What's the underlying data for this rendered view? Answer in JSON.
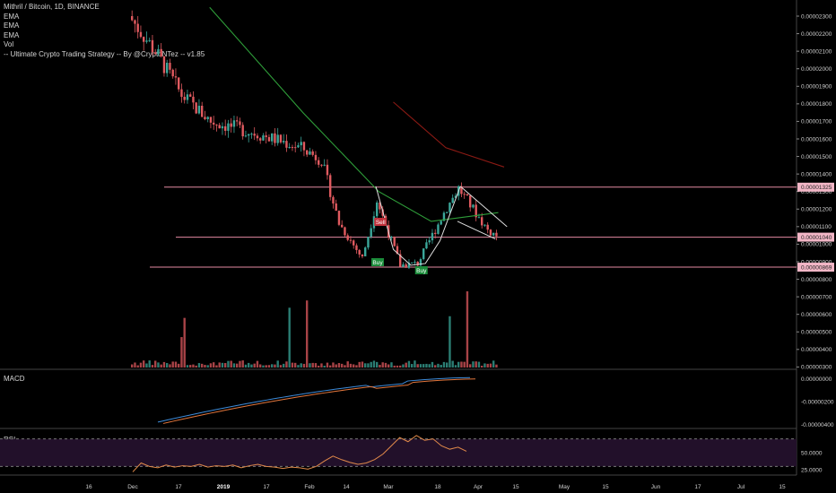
{
  "legend": {
    "title": "Mithril / Bitcoin, 1D, BINANCE",
    "lines": [
      "EMA",
      "EMA",
      "EMA",
      "Vol",
      "-- Ultimate Crypto Trading Strategy -- By @CryptoNTez -- v1.85"
    ]
  },
  "panes": {
    "macd": "MACD",
    "rsi": "RSI"
  },
  "colors": {
    "up": "#3aa79a",
    "down": "#e05a5f",
    "ema_green": "#2f9e3a",
    "ema_red": "#8b1a14",
    "level_line": "#e48aa2",
    "macd": "#3d8bd9",
    "signal": "#e2763c",
    "rsi_line": "#e0894a",
    "rsi_band": "#22102a",
    "buy": "#1b8c3a",
    "sell": "#c0303a",
    "pattern": "#dddddd"
  },
  "chart_data": {
    "type": "candlestick",
    "title": "Mithril / Bitcoin, 1D, BINANCE",
    "price_axis": {
      "ticks": [
        2.3e-05,
        2.2e-05,
        2.1e-05,
        2e-05,
        1.9e-05,
        1.8e-05,
        1.7e-05,
        1.6e-05,
        1.5e-05,
        1.4e-05,
        1.3e-05,
        1.2e-05,
        1.1e-05,
        1e-05,
        9e-06,
        8e-06,
        7e-06,
        6e-06,
        5e-06,
        4e-06,
        3e-06
      ],
      "tick_labels": [
        "0.00002300",
        "0.00002200",
        "0.00002100",
        "0.00002000",
        "0.00001900",
        "0.00001800",
        "0.00001700",
        "0.00001600",
        "0.00001500",
        "0.00001400",
        "0.00001300",
        "0.00001200",
        "0.00001100",
        "0.00001000",
        "0.00000900",
        "0.00000800",
        "0.00000700",
        "0.00000600",
        "0.00000500",
        "0.00000400",
        "0.00000300"
      ],
      "range": [
        3e-06,
        2.35e-05
      ]
    },
    "horizontal_levels": [
      {
        "value": 1.325e-05,
        "label": "0.00001325"
      },
      {
        "value": 1.04e-05,
        "label": "0.00001040"
      },
      {
        "value": 8.69e-06,
        "label": "0.00000869"
      }
    ],
    "x_axis": {
      "labels": [
        "16",
        "Dec",
        "17",
        "2019",
        "17",
        "Feb",
        "14",
        "Mar",
        "18",
        "Apr",
        "15",
        "May",
        "15",
        "Jun",
        "17",
        "Jul",
        "15"
      ]
    },
    "signals": [
      {
        "type": "Buy",
        "date": "2019-02-14"
      },
      {
        "type": "Sell",
        "date": "2019-02-15"
      },
      {
        "type": "Buy",
        "date": "2019-03-01"
      }
    ],
    "price_key_points": [
      {
        "date": "2018-11-22",
        "close": 2.3e-05
      },
      {
        "date": "2018-12-01",
        "close": 2.1e-05
      },
      {
        "date": "2018-12-10",
        "close": 1.85e-05
      },
      {
        "date": "2018-12-20",
        "close": 1.7e-05
      },
      {
        "date": "2019-01-05",
        "close": 1.63e-05
      },
      {
        "date": "2019-01-20",
        "close": 1.55e-05
      },
      {
        "date": "2019-01-27",
        "close": 1.48e-05
      },
      {
        "date": "2019-02-02",
        "close": 1.12e-05
      },
      {
        "date": "2019-02-10",
        "close": 9.2e-06
      },
      {
        "date": "2019-02-15",
        "close": 1.25e-05
      },
      {
        "date": "2019-02-23",
        "close": 8.8e-06
      },
      {
        "date": "2019-03-01",
        "close": 8.9e-06
      },
      {
        "date": "2019-03-10",
        "close": 1.18e-05
      },
      {
        "date": "2019-03-15",
        "close": 1.32e-05
      },
      {
        "date": "2019-03-25",
        "close": 1.08e-05
      },
      {
        "date": "2019-03-28",
        "close": 1.05e-05
      }
    ],
    "ema_green": [
      {
        "date": "2018-12-19",
        "value": 2.35e-05
      },
      {
        "date": "2019-01-20",
        "value": 1.75e-05
      },
      {
        "date": "2019-02-15",
        "value": 1.3e-05
      },
      {
        "date": "2019-03-05",
        "value": 1.13e-05
      },
      {
        "date": "2019-03-28",
        "value": 1.18e-05
      }
    ],
    "ema_red": [
      {
        "date": "2019-02-20",
        "value": 1.81e-05
      },
      {
        "date": "2019-03-10",
        "value": 1.55e-05
      },
      {
        "date": "2019-03-30",
        "value": 1.44e-05
      }
    ],
    "macd_axis": {
      "tick_labels": [
        "0.00000000",
        "-0.00000200",
        "-0.00000400"
      ],
      "range": [
        -4.2e-06,
        2e-07
      ]
    },
    "rsi_axis": {
      "tick_labels": [
        "50.0000",
        "25.0000"
      ],
      "bands": [
        30,
        70
      ]
    }
  }
}
